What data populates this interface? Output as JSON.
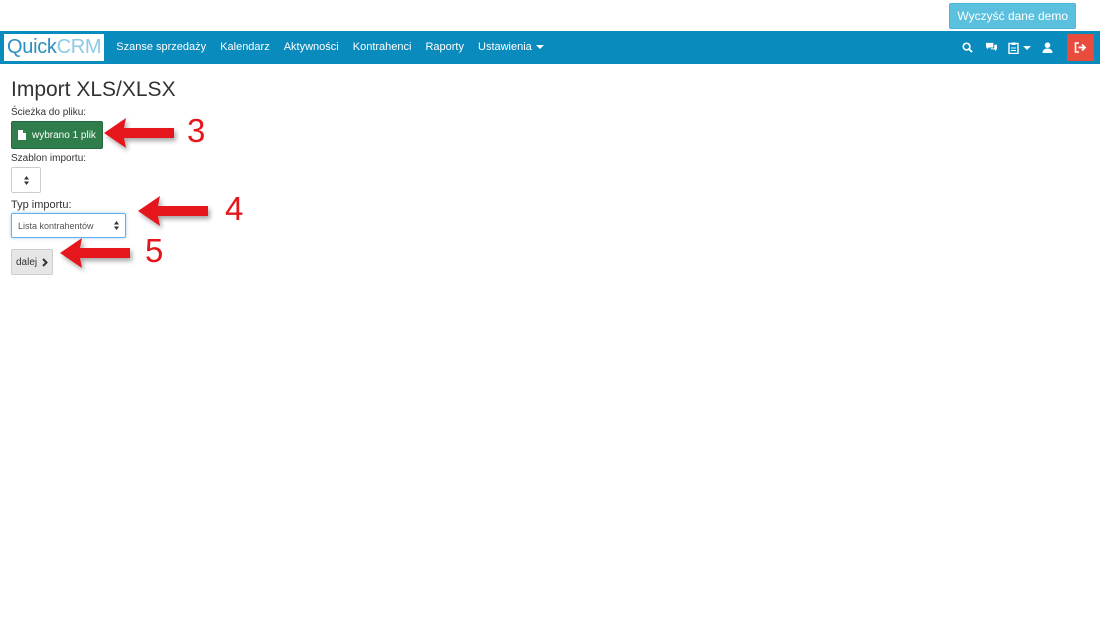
{
  "topbar": {
    "demo_button": "Wyczyść dane demo"
  },
  "navbar": {
    "brand_quick": "Quick",
    "brand_crm": "CRM",
    "items": [
      {
        "label": "Szanse sprzedaży"
      },
      {
        "label": "Kalendarz"
      },
      {
        "label": "Aktywności"
      },
      {
        "label": "Kontrahenci"
      },
      {
        "label": "Raporty"
      },
      {
        "label": "Ustawienia"
      }
    ],
    "icons": [
      "search-icon",
      "chat-icon",
      "clipboard-icon",
      "user-icon",
      "logout-icon"
    ]
  },
  "page": {
    "title": "Import XLS/XLSX",
    "file_path_label": "Ścieżka do pliku:",
    "file_button": "wybrano 1 plik",
    "template_label": "Szablon importu:",
    "template_value": "",
    "type_label": "Typ importu:",
    "type_value": "Lista kontrahentów",
    "next_button": "dalej"
  },
  "annotations": {
    "a3": "3",
    "a4": "4",
    "a5": "5"
  },
  "colors": {
    "navbar": "#0a8bbd",
    "demo_button": "#5bc0de",
    "file_button": "#2e7d4a",
    "logout": "#e74c3c",
    "annotation": "#e5161b"
  }
}
